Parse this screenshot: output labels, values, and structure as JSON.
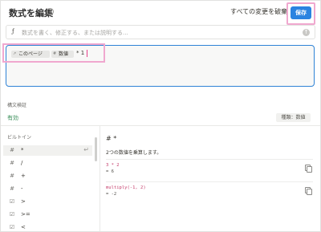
{
  "header": {
    "title": "数式を編集",
    "discard_label": "すべての変更を破棄",
    "save_label": "保存"
  },
  "formula_bar": {
    "placeholder": "数式を書く、修正する、または説明する..."
  },
  "editor": {
    "tokens": [
      {
        "icon": "↗",
        "label": "このページ"
      },
      {
        "icon": "#",
        "label": "数値"
      }
    ],
    "expression_text": "* 1"
  },
  "validation": {
    "label": "構文検証",
    "status": "有効",
    "type_badge": "種類：数値"
  },
  "builtin": {
    "label": "ビルトイン",
    "items": [
      {
        "icon": "#",
        "label": "*",
        "selected": true
      },
      {
        "icon": "#",
        "label": "/"
      },
      {
        "icon": "#",
        "label": "+"
      },
      {
        "icon": "#",
        "label": "-"
      },
      {
        "icon": "☑",
        "label": ">"
      },
      {
        "icon": "☑",
        "label": ">="
      },
      {
        "icon": "☑",
        "label": "<"
      }
    ]
  },
  "detail": {
    "title": "# *",
    "description": "2つの数値を乗算します。",
    "examples": [
      {
        "code": "3 * 2",
        "result": "= 6"
      },
      {
        "code": "multiply(-1, 2)",
        "result": "= -2"
      }
    ]
  }
}
